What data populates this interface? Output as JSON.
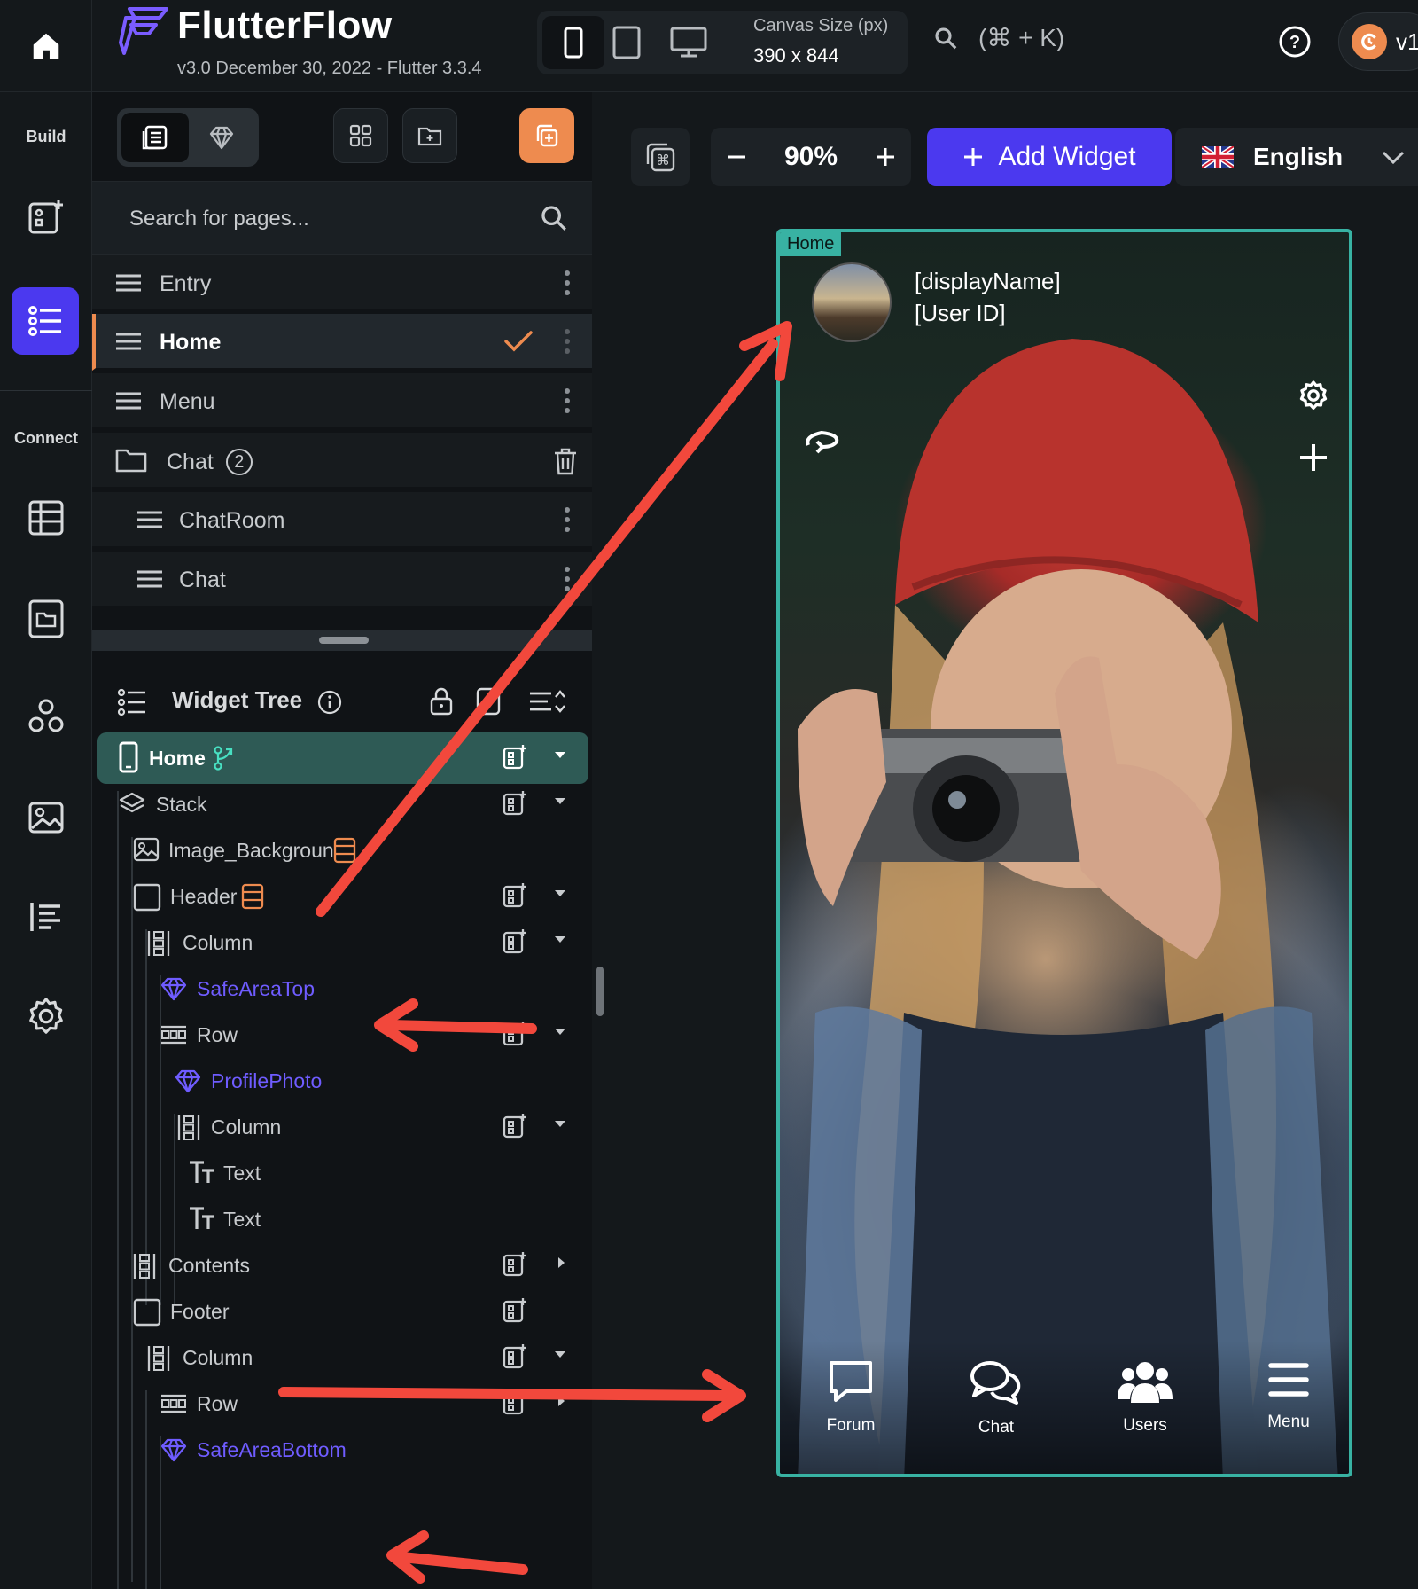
{
  "app": {
    "title": "FlutterFlow",
    "subtitle": "v3.0 December 30, 2022 - Flutter 3.3.4",
    "version_label": "v1"
  },
  "topbar": {
    "canvas_size_label": "Canvas Size (px)",
    "canvas_size_value": "390 x 844",
    "shortcut": "(⌘ + K)"
  },
  "rail": {
    "build_label": "Build",
    "connect_label": "Connect"
  },
  "pages": {
    "search_placeholder": "Search for pages...",
    "items": [
      {
        "label": "Entry"
      },
      {
        "label": "Home"
      },
      {
        "label": "Menu"
      },
      {
        "label": "Chat",
        "count": "2"
      },
      {
        "label": "ChatRoom"
      },
      {
        "label": "Chat"
      }
    ]
  },
  "widget_tree": {
    "title": "Widget Tree",
    "nodes": [
      {
        "label": "Home"
      },
      {
        "label": "Stack"
      },
      {
        "label": "Image_Backgroun"
      },
      {
        "label": "Header"
      },
      {
        "label": "Column"
      },
      {
        "label": "SafeAreaTop"
      },
      {
        "label": "Row"
      },
      {
        "label": "ProfilePhoto"
      },
      {
        "label": "Column"
      },
      {
        "label": "Text"
      },
      {
        "label": "Text"
      },
      {
        "label": "Contents"
      },
      {
        "label": "Footer"
      },
      {
        "label": "Column"
      },
      {
        "label": "Row"
      },
      {
        "label": "SafeAreaBottom"
      }
    ]
  },
  "canvas": {
    "zoom": "90%",
    "add_widget_label": "Add Widget",
    "language": "English",
    "page_tag": "Home"
  },
  "phone": {
    "display_name": "[displayName]",
    "user_id": "[User ID]",
    "nav": [
      {
        "label": "Forum",
        "icon": "chat-bubble-icon"
      },
      {
        "label": "Chat",
        "icon": "chat-bubbles-icon"
      },
      {
        "label": "Users",
        "icon": "users-icon"
      },
      {
        "label": "Menu",
        "icon": "menu-icon"
      }
    ]
  },
  "colors": {
    "accent": "#4b39ef",
    "orange": "#ee8b4f",
    "teal": "#38b2a3",
    "component": "#6f5cff",
    "annotation": "#f2483c"
  }
}
